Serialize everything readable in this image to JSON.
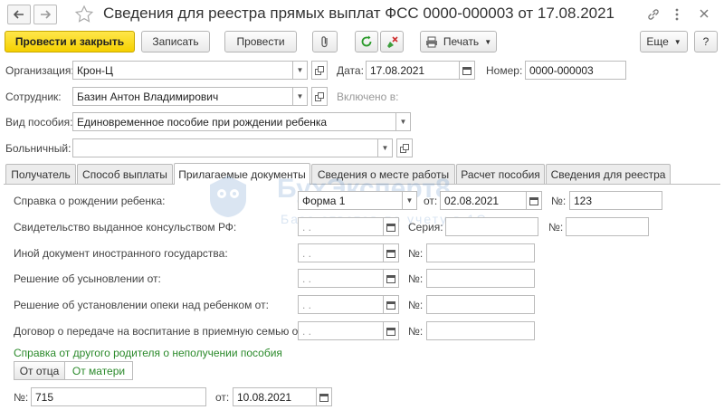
{
  "window": {
    "title": "Сведения для реестра прямых выплат ФСС 0000-000003 от 17.08.2021"
  },
  "icons": {
    "back": "arrow-left-icon",
    "forward": "arrow-right-icon",
    "favorite": "star-icon",
    "link": "link-icon",
    "more": "kebab-icon",
    "close": "close-icon"
  },
  "toolbar": {
    "post_close": "Провести и закрыть",
    "save": "Записать",
    "post": "Провести",
    "print": "Печать",
    "more": "Еще",
    "help": "?"
  },
  "header": {
    "org_label": "Организация:",
    "org_value": "Крон-Ц",
    "date_label": "Дата:",
    "date_value": "17.08.2021",
    "number_label": "Номер:",
    "number_value": "0000-000003",
    "employee_label": "Сотрудник:",
    "employee_value": "Базин Антон Владимирович",
    "included_label": "Включено в:",
    "benefit_label": "Вид пособия:",
    "benefit_value": "Единовременное пособие при рождении ребенка",
    "sick_label": "Больничный:",
    "sick_value": ""
  },
  "tabs": [
    {
      "label": "Получатель"
    },
    {
      "label": "Способ выплаты"
    },
    {
      "label": "Прилагаемые документы"
    },
    {
      "label": "Сведения о месте работы"
    },
    {
      "label": "Расчет пособия"
    },
    {
      "label": "Сведения для реестра"
    }
  ],
  "watermark": {
    "title": "БухЭксперт8",
    "subtitle": "База ответов по учету в 1С"
  },
  "docs": {
    "birth_label": "Справка о рождении ребенка:",
    "birth_form": "Форма 1",
    "birth_from_label": "от:",
    "birth_date": "02.08.2021",
    "birth_no_label": "№:",
    "birth_no": "123",
    "consul_label": "Свидетельство выданное консульством РФ:",
    "consul_date": " .  .",
    "consul_series_label": "Серия:",
    "consul_no_label": "№:",
    "foreign_label": "Иной документ иностранного государства:",
    "foreign_date": " .  .",
    "foreign_no_label": "№:",
    "adoption_label": "Решение об усыновлении от:",
    "adoption_date": " .  .",
    "adoption_no_label": "№:",
    "guardian_label": "Решение об установлении опеки над ребенком от:",
    "guardian_date": " .  .",
    "guardian_no_label": "№:",
    "foster_label": "Договор о передаче на воспитание в приемную семью от:",
    "foster_date": " .  .",
    "foster_no_label": "№:",
    "other_parent_heading": "Справка от другого родителя о неполучении пособия",
    "from_father": "От отца",
    "from_mother": "От матери",
    "cert_no_label": "№:",
    "cert_no": "715",
    "cert_from_label": "от:",
    "cert_date": "10.08.2021"
  }
}
